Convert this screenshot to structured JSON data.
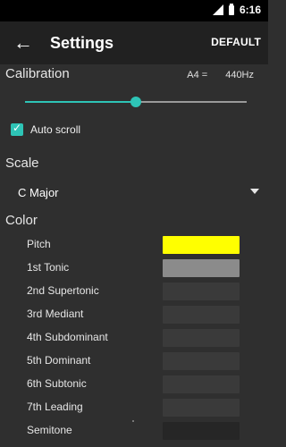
{
  "status_bar": {
    "time": "6:16"
  },
  "app_bar": {
    "title": "Settings",
    "action_label": "DEFAULT",
    "back_icon": "back-arrow-icon"
  },
  "calibration": {
    "title": "Calibration",
    "label": "A4 =",
    "value": "440Hz",
    "slider_fraction": 0.5
  },
  "auto_scroll": {
    "label": "Auto scroll",
    "checked": true
  },
  "scale": {
    "title": "Scale",
    "selected": "C Major"
  },
  "color": {
    "title": "Color",
    "items": [
      {
        "label": "Pitch",
        "swatch": "#ffff00"
      },
      {
        "label": "1st Tonic",
        "swatch": "#8b8b8b"
      },
      {
        "label": "2nd Supertonic",
        "swatch": "#3a3a3a"
      },
      {
        "label": "3rd Mediant",
        "swatch": "#3a3a3a"
      },
      {
        "label": "4th Subdominant",
        "swatch": "#3a3a3a"
      },
      {
        "label": "5th Dominant",
        "swatch": "#3a3a3a"
      },
      {
        "label": "6th Subtonic",
        "swatch": "#3a3a3a"
      },
      {
        "label": "7th Leading",
        "swatch": "#3a3a3a"
      },
      {
        "label": "Semitone",
        "swatch": "#262626"
      }
    ]
  },
  "theme": {
    "accent": "#2ec4b6",
    "background": "#2f2f2f",
    "app_bar": "#212121",
    "status_bar": "#000000"
  }
}
